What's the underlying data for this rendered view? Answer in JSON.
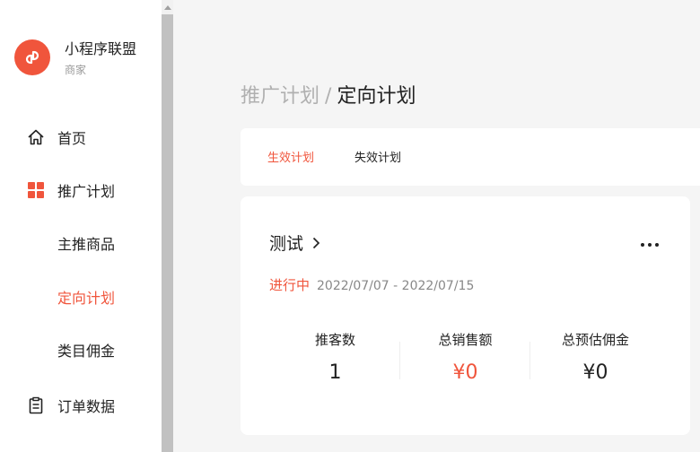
{
  "brand": {
    "name": "小程序联盟",
    "role": "商家",
    "logo_icon": "link-chain-icon",
    "accent": "#f0553c"
  },
  "sidebar": {
    "items": [
      {
        "label": "首页",
        "icon": "home-icon"
      },
      {
        "label": "推广计划",
        "icon": "grid-icon"
      },
      {
        "label": "主推商品"
      },
      {
        "label": "定向计划"
      },
      {
        "label": "类目佣金"
      },
      {
        "label": "订单数据",
        "icon": "clipboard-icon"
      }
    ]
  },
  "breadcrumb": {
    "parent": "推广计划",
    "separator": "/",
    "current": "定向计划"
  },
  "tabs": [
    {
      "label": "生效计划"
    },
    {
      "label": "失效计划"
    }
  ],
  "plan": {
    "title": "测试",
    "status": "进行中",
    "date_range": "2022/07/07 - 2022/07/15",
    "stats": [
      {
        "label": "推客数",
        "value": "1"
      },
      {
        "label": "总销售额",
        "value": "¥0"
      },
      {
        "label": "总预估佣金",
        "value": "¥0"
      }
    ]
  }
}
